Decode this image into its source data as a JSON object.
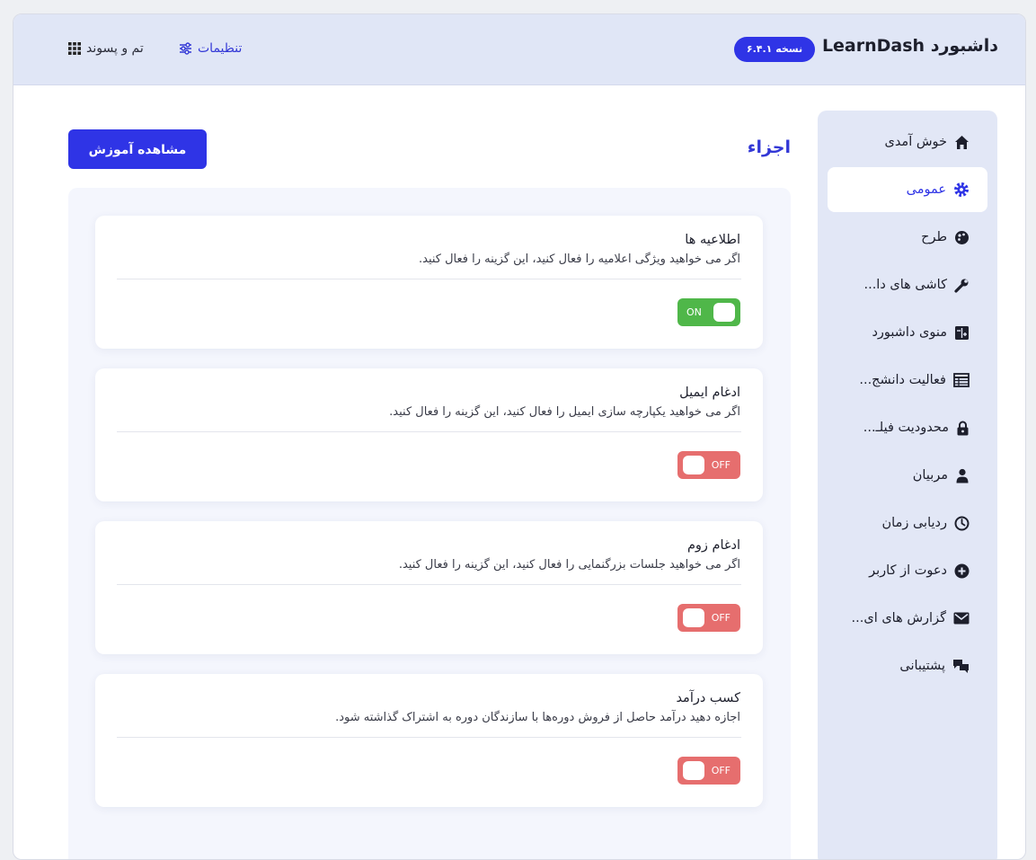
{
  "header": {
    "title": "داشبورد LearnDash",
    "version": "نسخه ۶.۴.۱",
    "settings_link": "تنظیمات",
    "theme_link": "تم و پسوند"
  },
  "sidebar": {
    "items": [
      {
        "label": "خوش آمدی",
        "icon": "home-icon"
      },
      {
        "label": "عمومی",
        "icon": "gear-icon"
      },
      {
        "label": "طرح",
        "icon": "palette-icon"
      },
      {
        "label": "کاشی های دا...",
        "icon": "wrench-icon"
      },
      {
        "label": "منوی داشبورد",
        "icon": "menu-editor-icon"
      },
      {
        "label": "فعالیت دانشج...",
        "icon": "table-icon"
      },
      {
        "label": "محدودیت فیلـ...",
        "icon": "lock-icon"
      },
      {
        "label": "مربیان",
        "icon": "instructor-icon"
      },
      {
        "label": "ردیابی زمان",
        "icon": "clock-icon"
      },
      {
        "label": "دعوت از کاربر",
        "icon": "plus-circle-icon"
      },
      {
        "label": "گزارش های ای...",
        "icon": "envelope-icon"
      },
      {
        "label": "پشتیبانی",
        "icon": "chat-icon"
      }
    ],
    "active_index": 1
  },
  "main": {
    "section_title": "اجزاء",
    "view_button": "مشاهده آموزش",
    "cards": [
      {
        "title": "اطلاعیه ها",
        "description": "اگر می خواهید ویژگی اعلامیه را فعال کنید، این گزینه را فعال کنید.",
        "toggle": "ON",
        "enabled": true
      },
      {
        "title": "ادغام ایمیل",
        "description": "اگر می خواهید یکپارچه سازی ایمیل را فعال کنید، این گزینه را فعال کنید.",
        "toggle": "OFF",
        "enabled": false
      },
      {
        "title": "ادغام زوم",
        "description": "اگر می خواهید جلسات بزرگنمایی را فعال کنید، این گزینه را فعال کنید.",
        "toggle": "OFF",
        "enabled": false
      },
      {
        "title": "کسب درآمد",
        "description": "اجازه دهید درآمد حاصل از فروش دوره‌ها با سازندگان دوره به اشتراک گذاشته شود.",
        "toggle": "OFF",
        "enabled": false
      }
    ]
  },
  "colors": {
    "accent": "#2f34e6",
    "toggle_on": "#4fb749",
    "toggle_off": "#e66e6e",
    "header_bg": "#e0e6f6"
  }
}
